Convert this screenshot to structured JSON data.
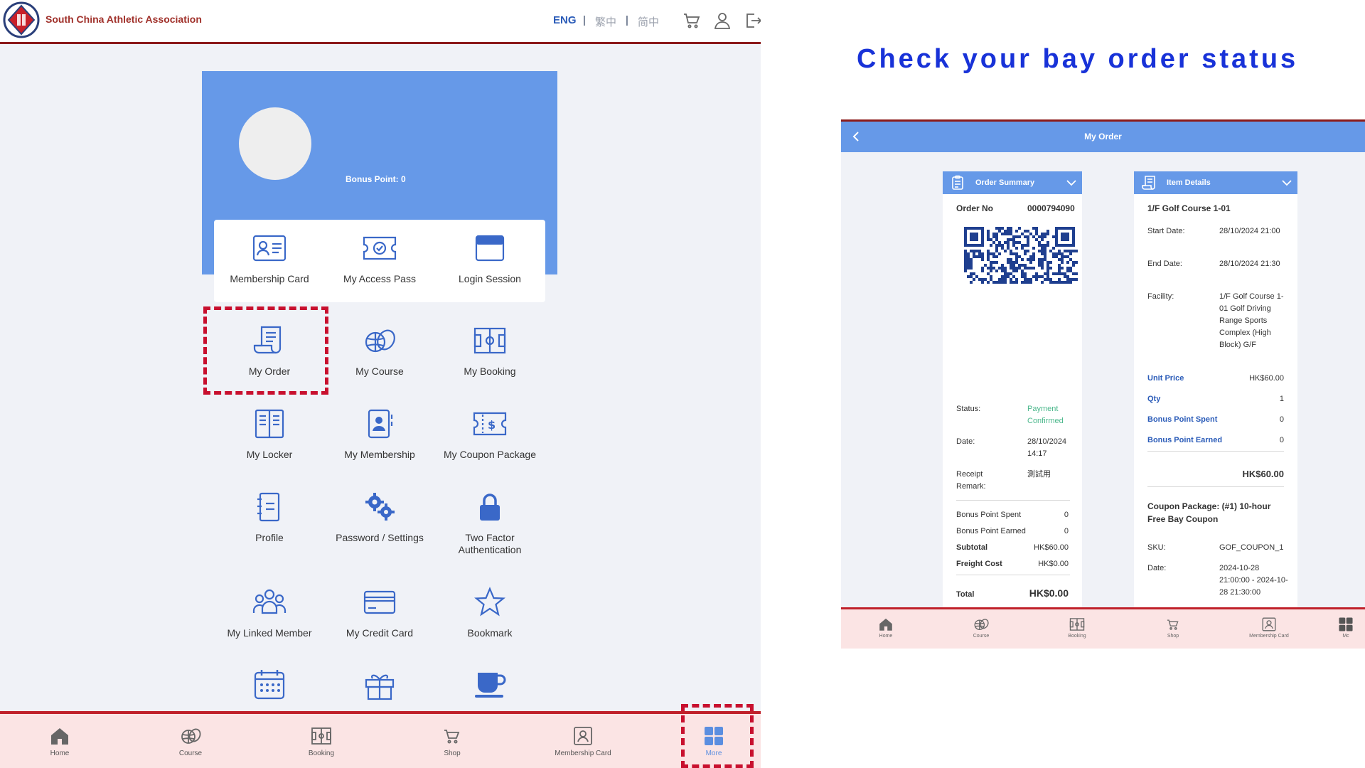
{
  "colors": {
    "accent_blue": "#6699e8",
    "icon_blue": "#3a68c8",
    "brand_red": "#a0302a",
    "highlight_red": "#c8102e",
    "nav_bg": "#fbe4e4",
    "headline_blue": "#1832d8",
    "confirmed_green": "#4cb88c"
  },
  "header": {
    "brand": "South China Athletic Association",
    "lang_eng": "ENG",
    "lang_sep": "|",
    "lang_tc": "繁中",
    "lang_sc": "简中",
    "icons": [
      "cart-icon",
      "user-icon",
      "logout-icon"
    ]
  },
  "profile": {
    "bonus_point": "Bonus Point: 0"
  },
  "quick_links": [
    {
      "label": "Membership Card",
      "icon": "id-card-icon"
    },
    {
      "label": "My Access Pass",
      "icon": "ticket-icon"
    },
    {
      "label": "Login Session",
      "icon": "window-icon"
    }
  ],
  "menu": [
    {
      "label": "My Order",
      "icon": "receipt-icon"
    },
    {
      "label": "My Course",
      "icon": "sports-balls-icon"
    },
    {
      "label": "My Booking",
      "icon": "court-icon"
    },
    {
      "label": "My Locker",
      "icon": "locker-icon"
    },
    {
      "label": "My Membership",
      "icon": "member-book-icon"
    },
    {
      "label": "My Coupon Package",
      "icon": "coupon-icon"
    },
    {
      "label": "Profile",
      "icon": "profile-icon"
    },
    {
      "label": "Password / Settings",
      "icon": "gears-icon"
    },
    {
      "label": "Two Factor Authentication",
      "icon": "lock-icon"
    },
    {
      "label": "My Linked Member",
      "icon": "group-icon"
    },
    {
      "label": "My Credit Card",
      "icon": "credit-card-icon"
    },
    {
      "label": "Bookmark",
      "icon": "star-icon"
    },
    {
      "label": "",
      "icon": "calendar-icon"
    },
    {
      "label": "",
      "icon": "gift-icon"
    },
    {
      "label": "",
      "icon": "cup-icon"
    }
  ],
  "bottom_nav": [
    {
      "label": "Home",
      "icon": "home-icon"
    },
    {
      "label": "Course",
      "icon": "sports-balls-icon"
    },
    {
      "label": "Booking",
      "icon": "court-icon"
    },
    {
      "label": "Shop",
      "icon": "cart-icon"
    },
    {
      "label": "Membership Card",
      "icon": "member-card-icon"
    },
    {
      "label": "More",
      "icon": "grid-icon",
      "active": true
    }
  ],
  "headline": "Check your bay order status",
  "my_order": {
    "title": "My Order",
    "summary": {
      "title": "Order Summary",
      "order_no_label": "Order No",
      "order_no": "0000794090",
      "status_label": "Status:",
      "status_value": "Payment Confirmed",
      "date_label": "Date:",
      "date_value": "28/10/2024 14:17",
      "receipt_label": "Receipt Remark:",
      "receipt_value": "測試用",
      "bonus_spent_label": "Bonus Point Spent",
      "bonus_spent": "0",
      "bonus_earned_label": "Bonus Point Earned",
      "bonus_earned": "0",
      "subtotal_label": "Subtotal",
      "subtotal": "HK$60.00",
      "freight_label": "Freight Cost",
      "freight": "HK$0.00",
      "total_label": "Total",
      "total": "HK$0.00"
    },
    "items": {
      "title": "Item Details",
      "item_name": "1/F Golf Course 1-01",
      "start_label": "Start Date:",
      "start_value": "28/10/2024 21:00",
      "end_label": "End Date:",
      "end_value": "28/10/2024 21:30",
      "facility_label": "Facility:",
      "facility_value": "1/F Golf Course 1-01 Golf Driving Range Sports Complex (High Block) G/F",
      "unit_price_label": "Unit Price",
      "unit_price": "HK$60.00",
      "qty_label": "Qty",
      "qty": "1",
      "bp_spent_label": "Bonus Point Spent",
      "bp_spent": "0",
      "bp_earned_label": "Bonus Point Earned",
      "bp_earned": "0",
      "item_total": "HK$60.00",
      "coupon_title": "Coupon Package: (#1) 10-hour Free Bay Coupon",
      "sku_label": "SKU:",
      "sku_value": "GOF_COUPON_1",
      "coupon_date_label": "Date:",
      "coupon_date_value": "2024-10-28 21:00:00 - 2024-10-28 21:30:00"
    },
    "bottom_nav": [
      {
        "label": "Home",
        "icon": "home-icon"
      },
      {
        "label": "Course",
        "icon": "sports-balls-icon"
      },
      {
        "label": "Booking",
        "icon": "court-icon"
      },
      {
        "label": "Shop",
        "icon": "cart-icon"
      },
      {
        "label": "Membership Card",
        "icon": "member-card-icon"
      },
      {
        "label": "Mc",
        "icon": "grid-icon"
      }
    ]
  }
}
